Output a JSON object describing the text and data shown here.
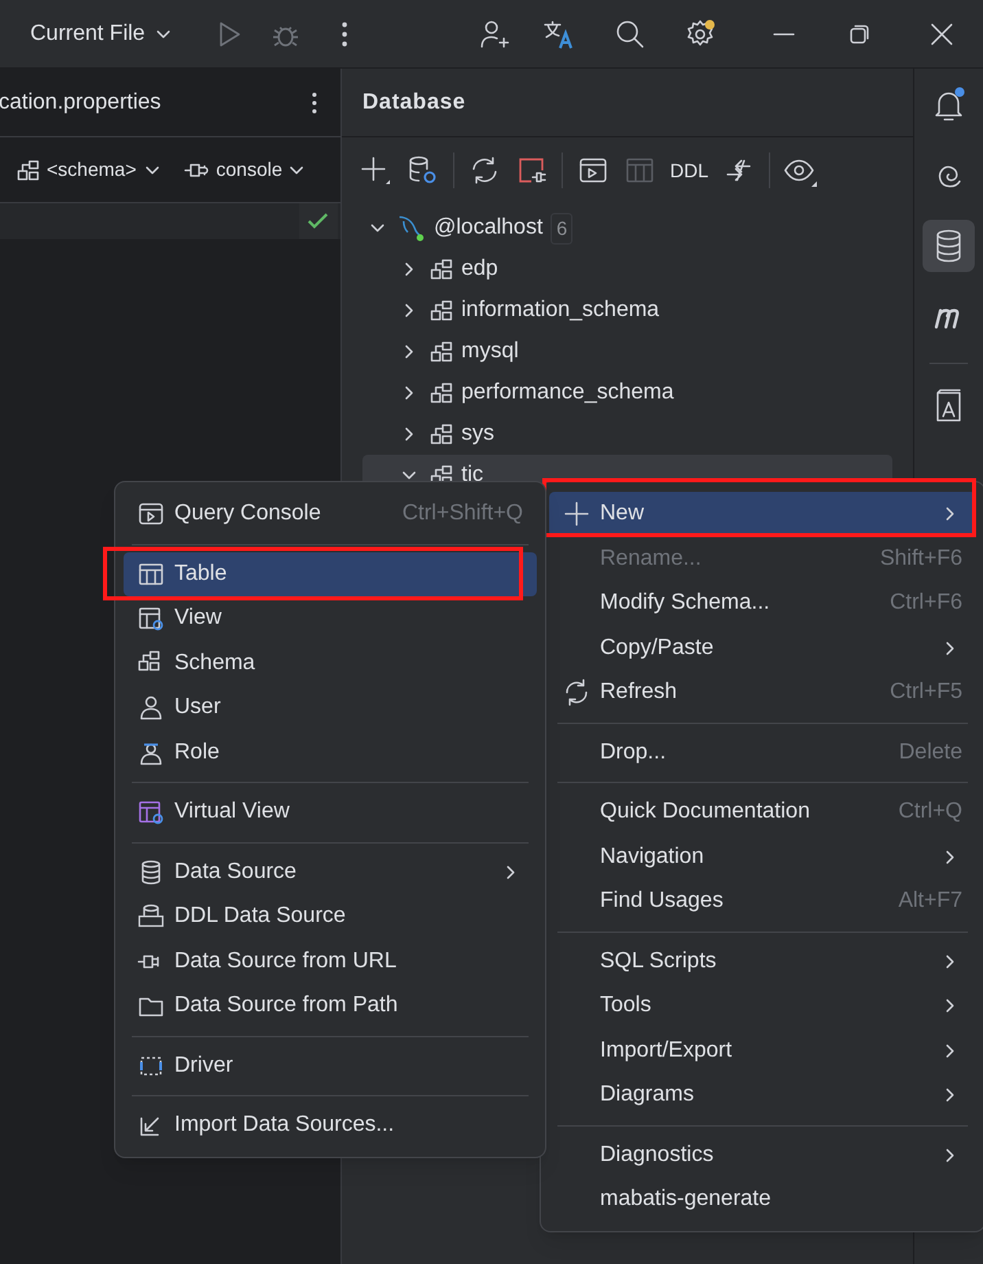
{
  "title_bar": {
    "run_config": "Current File"
  },
  "editor": {
    "tab_title": "cation.properties",
    "schema_selector": "<schema>",
    "session_selector": "console"
  },
  "database_panel": {
    "title": "Database",
    "toolbar": {
      "ddl_label": "DDL"
    },
    "tree": [
      {
        "label": "@localhost",
        "count": "6",
        "expanded": true,
        "selected": false,
        "children": [
          {
            "label": "edp",
            "expanded": false,
            "selected": false
          },
          {
            "label": "information_schema",
            "expanded": false,
            "selected": false
          },
          {
            "label": "mysql",
            "expanded": false,
            "selected": false
          },
          {
            "label": "performance_schema",
            "expanded": false,
            "selected": false
          },
          {
            "label": "sys",
            "expanded": false,
            "selected": false
          },
          {
            "label": "tic",
            "expanded": true,
            "selected": true
          }
        ]
      }
    ]
  },
  "new_submenu": {
    "groups": [
      [
        {
          "label": "Query Console",
          "shortcut": "Ctrl+Shift+Q",
          "submenu": false,
          "selected": false,
          "outlined": false
        }
      ],
      [
        {
          "label": "Table",
          "submenu": false,
          "selected": true,
          "outlined": true
        },
        {
          "label": "View",
          "submenu": false,
          "selected": false,
          "outlined": false
        },
        {
          "label": "Schema",
          "submenu": false,
          "selected": false,
          "outlined": false
        },
        {
          "label": "User",
          "submenu": false,
          "selected": false,
          "outlined": false
        },
        {
          "label": "Role",
          "submenu": false,
          "selected": false,
          "outlined": false
        }
      ],
      [
        {
          "label": "Virtual View",
          "submenu": false,
          "selected": false,
          "outlined": false
        }
      ],
      [
        {
          "label": "Data Source",
          "submenu": true,
          "selected": false,
          "outlined": false
        },
        {
          "label": "DDL Data Source",
          "submenu": false,
          "selected": false,
          "outlined": false
        },
        {
          "label": "Data Source from URL",
          "submenu": false,
          "selected": false,
          "outlined": false
        },
        {
          "label": "Data Source from Path",
          "submenu": false,
          "selected": false,
          "outlined": false
        }
      ],
      [
        {
          "label": "Driver",
          "submenu": false,
          "selected": false,
          "outlined": false
        }
      ],
      [
        {
          "label": "Import Data Sources...",
          "submenu": false,
          "selected": false,
          "outlined": false
        }
      ]
    ]
  },
  "context_menu": {
    "groups": [
      [
        {
          "label": "New",
          "submenu": true,
          "selected": true,
          "outlined": true,
          "disabled": false
        },
        {
          "label": "Rename...",
          "shortcut": "Shift+F6",
          "submenu": false,
          "selected": false,
          "outlined": false,
          "disabled": true
        },
        {
          "label": "Modify Schema...",
          "shortcut": "Ctrl+F6",
          "submenu": false,
          "selected": false,
          "outlined": false,
          "disabled": false
        },
        {
          "label": "Copy/Paste",
          "submenu": true,
          "selected": false,
          "outlined": false,
          "disabled": false
        },
        {
          "label": "Refresh",
          "shortcut": "Ctrl+F5",
          "submenu": false,
          "selected": false,
          "outlined": false,
          "disabled": false
        }
      ],
      [
        {
          "label": "Drop...",
          "shortcut": "Delete",
          "submenu": false,
          "selected": false,
          "outlined": false,
          "disabled": false
        }
      ],
      [
        {
          "label": "Quick Documentation",
          "shortcut": "Ctrl+Q",
          "submenu": false,
          "selected": false,
          "outlined": false,
          "disabled": false
        },
        {
          "label": "Navigation",
          "submenu": true,
          "selected": false,
          "outlined": false,
          "disabled": false
        },
        {
          "label": "Find Usages",
          "shortcut": "Alt+F7",
          "submenu": false,
          "selected": false,
          "outlined": false,
          "disabled": false
        }
      ],
      [
        {
          "label": "SQL Scripts",
          "submenu": true,
          "selected": false,
          "outlined": false,
          "disabled": false
        },
        {
          "label": "Tools",
          "submenu": true,
          "selected": false,
          "outlined": false,
          "disabled": false
        },
        {
          "label": "Import/Export",
          "submenu": true,
          "selected": false,
          "outlined": false,
          "disabled": false
        },
        {
          "label": "Diagrams",
          "submenu": true,
          "selected": false,
          "outlined": false,
          "disabled": false
        }
      ],
      [
        {
          "label": "Diagnostics",
          "submenu": true,
          "selected": false,
          "outlined": false,
          "disabled": false
        },
        {
          "label": "mabatis-generate",
          "submenu": false,
          "selected": false,
          "outlined": false,
          "disabled": false
        }
      ]
    ]
  }
}
